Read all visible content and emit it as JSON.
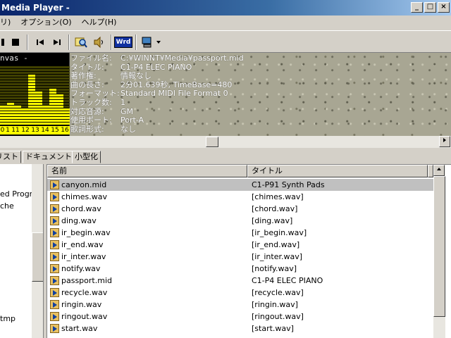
{
  "window": {
    "title": "Media Player -",
    "controls": [
      "_",
      "□",
      "×"
    ]
  },
  "menu": [
    "リ)",
    "オプション(O)",
    "ヘルプ(H)"
  ],
  "toolbar": {
    "icons": [
      "stop-icon",
      "prev-track-icon",
      "next-track-icon",
      "search-icon",
      "speaker-icon",
      "wrd-icon",
      "export-icon"
    ],
    "wrd_label": "Wrd"
  },
  "equalizer": {
    "title": "nvas -",
    "channels": [
      "0",
      "1",
      "11",
      "12",
      "13",
      "14",
      "15",
      "16"
    ],
    "levels": [
      0.34,
      0.36,
      0.33,
      0.3,
      0.85,
      0.58,
      0.32,
      0.6,
      0.5,
      0.3
    ],
    "colors": {
      "on": "#ffff00",
      "off": "#404000"
    }
  },
  "fileinfo": [
    {
      "label": "ファイル名:",
      "value": "C:¥WINNT¥Media¥passport.mid"
    },
    {
      "label": "タイトル:",
      "value": "C1-P4 ELEC PIANO"
    },
    {
      "label": "著作権:",
      "value": "情報なし"
    },
    {
      "label": "曲の長さ:",
      "value": "2分01.639秒, TimeBase=480"
    },
    {
      "label": "フォーマット:",
      "value": "Standard MIDI File Format 0"
    },
    {
      "label": "トラック数:",
      "value": "1"
    },
    {
      "label": "対応音源:",
      "value": "GM"
    },
    {
      "label": "使用ポート:",
      "value": "Port-A"
    },
    {
      "label": "歌詞形式:",
      "value": "なし"
    }
  ],
  "tabs": [
    "リスト",
    "ドキュメント",
    "小型化"
  ],
  "tree": {
    "items": [
      "ed Progra",
      "che",
      "tmp"
    ]
  },
  "list": {
    "columns": [
      "名前",
      "タイトル"
    ],
    "rows": [
      {
        "name": "canyon.mid",
        "title": "C1-P91 Synth Pads",
        "selected": true
      },
      {
        "name": "chimes.wav",
        "title": "[chimes.wav]"
      },
      {
        "name": "chord.wav",
        "title": "[chord.wav]"
      },
      {
        "name": "ding.wav",
        "title": "[ding.wav]"
      },
      {
        "name": "ir_begin.wav",
        "title": "[ir_begin.wav]"
      },
      {
        "name": "ir_end.wav",
        "title": "[ir_end.wav]"
      },
      {
        "name": "ir_inter.wav",
        "title": "[ir_inter.wav]"
      },
      {
        "name": "notify.wav",
        "title": "[notify.wav]"
      },
      {
        "name": "passport.mid",
        "title": "C1-P4 ELEC PIANO"
      },
      {
        "name": "recycle.wav",
        "title": "[recycle.wav]"
      },
      {
        "name": "ringin.wav",
        "title": "[ringin.wav]"
      },
      {
        "name": "ringout.wav",
        "title": "[ringout.wav]"
      },
      {
        "name": "start.wav",
        "title": "[start.wav]"
      }
    ]
  }
}
